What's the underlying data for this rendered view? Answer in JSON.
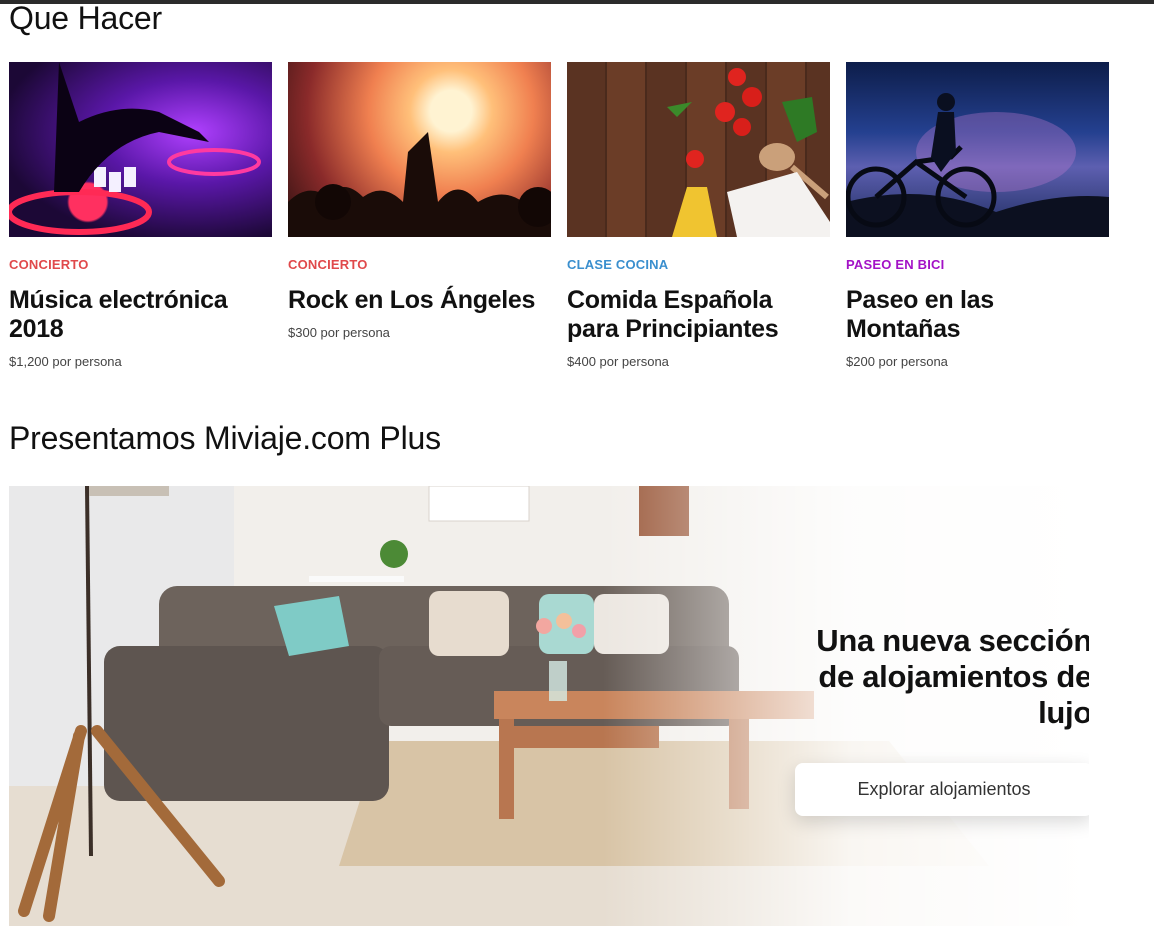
{
  "colors": {
    "concierto": "#e0494b",
    "clase_cocina": "#3a8fce",
    "paseo_bici": "#a312c6"
  },
  "section1": {
    "title": "Que Hacer"
  },
  "cards": [
    {
      "category": "Concierto",
      "title": "Música electrónica 2018",
      "price": "$1,200 por persona",
      "image": "dj-mixer-image"
    },
    {
      "category": "Concierto",
      "title": "Rock en Los Ángeles",
      "price": "$300 por persona",
      "image": "concert-crowd-image"
    },
    {
      "category": "Clase Cocina",
      "title": "Comida Española para Principiantes",
      "price": "$400 por persona",
      "image": "food-ingredients-image"
    },
    {
      "category": "Paseo en Bici",
      "title": "Paseo en las Montañas",
      "price": "$200 por persona",
      "image": "cyclist-night-image"
    }
  ],
  "section2": {
    "title": "Presentamos Miviaje.com Plus"
  },
  "banner": {
    "headline": "Una nueva sección de alojamientos de lujo",
    "button_label": "Explorar alojamientos",
    "image": "living-room-image"
  }
}
